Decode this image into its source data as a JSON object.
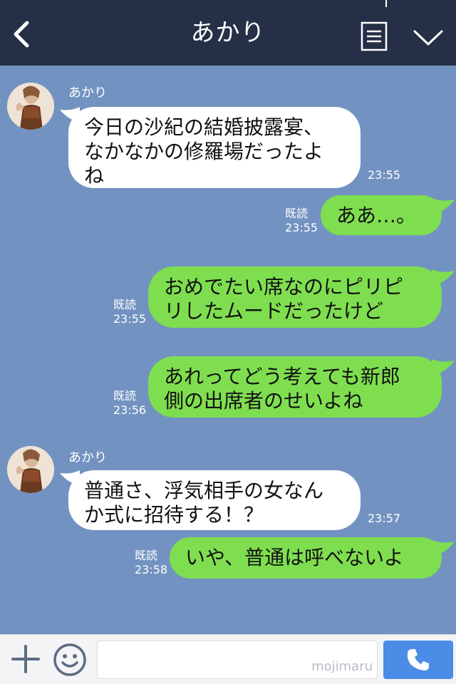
{
  "header": {
    "title": "あかり",
    "back_icon": "chevron-left-icon",
    "menu_icon": "note-icon",
    "collapse_icon": "chevron-down-icon"
  },
  "messages": [
    {
      "side": "in",
      "sender": "あかり",
      "text": "今日の沙紀の結婚披露宴、\nなかなかの修羅場だったよ\nね",
      "time": "23:55"
    },
    {
      "side": "out",
      "read": "既読",
      "text": "ああ…。",
      "time": "23:55"
    },
    {
      "side": "out",
      "read": "既読",
      "text": "おめでたい席なのにピリピ\nリしたムードだったけど",
      "time": "23:55"
    },
    {
      "side": "out",
      "read": "既読",
      "text": "あれってどう考えても新郎\n側の出席者のせいよね",
      "time": "23:56"
    },
    {
      "side": "in",
      "sender": "あかり",
      "text": "普通さ、浮気相手の女なん\nか式に招待する！？",
      "time": "23:57"
    },
    {
      "side": "out",
      "read": "既読",
      "text": "いや、普通は呼べないよ",
      "time": "23:58"
    }
  ],
  "input": {
    "placeholder": "",
    "watermark": "mojimaru"
  },
  "colors": {
    "background": "#7293c1",
    "header": "#252f45",
    "outgoing": "#7fde4f",
    "incoming": "#ffffff",
    "call_button": "#4b8ce6"
  }
}
